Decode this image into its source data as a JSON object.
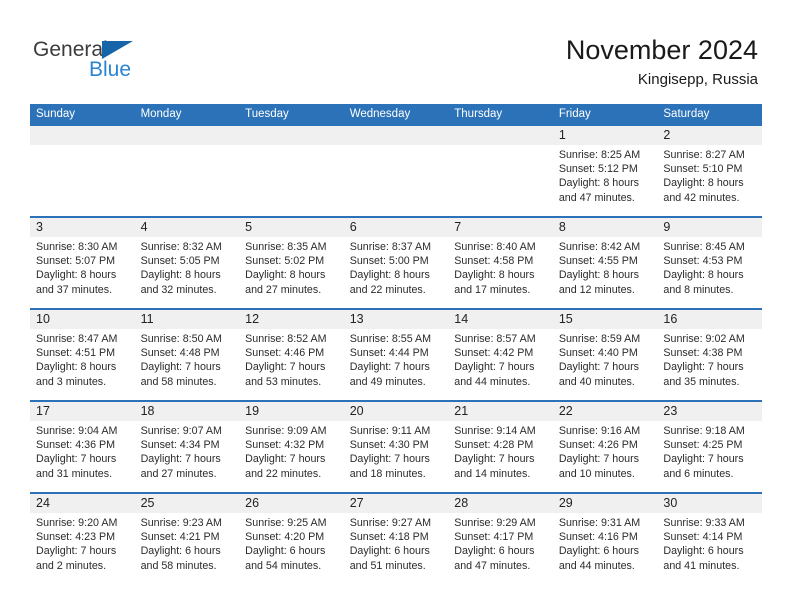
{
  "brand": {
    "name_top": "General",
    "name_bottom": "Blue",
    "color_dark": "#3c3c3c",
    "color_blue": "#2a84d2",
    "triangle_color": "#1565a8"
  },
  "header": {
    "month_title": "November 2024",
    "location": "Kingisepp, Russia"
  },
  "theme": {
    "header_blue": "#2c72b8",
    "date_band_gray": "#f0f0f0",
    "text": "#2b2b2b"
  },
  "weekday_headers": [
    "Sunday",
    "Monday",
    "Tuesday",
    "Wednesday",
    "Thursday",
    "Friday",
    "Saturday"
  ],
  "weeks": [
    [
      {
        "date": "",
        "lines": []
      },
      {
        "date": "",
        "lines": []
      },
      {
        "date": "",
        "lines": []
      },
      {
        "date": "",
        "lines": []
      },
      {
        "date": "",
        "lines": []
      },
      {
        "date": "1",
        "lines": [
          "Sunrise: 8:25 AM",
          "Sunset: 5:12 PM",
          "Daylight: 8 hours",
          "and 47 minutes."
        ]
      },
      {
        "date": "2",
        "lines": [
          "Sunrise: 8:27 AM",
          "Sunset: 5:10 PM",
          "Daylight: 8 hours",
          "and 42 minutes."
        ]
      }
    ],
    [
      {
        "date": "3",
        "lines": [
          "Sunrise: 8:30 AM",
          "Sunset: 5:07 PM",
          "Daylight: 8 hours",
          "and 37 minutes."
        ]
      },
      {
        "date": "4",
        "lines": [
          "Sunrise: 8:32 AM",
          "Sunset: 5:05 PM",
          "Daylight: 8 hours",
          "and 32 minutes."
        ]
      },
      {
        "date": "5",
        "lines": [
          "Sunrise: 8:35 AM",
          "Sunset: 5:02 PM",
          "Daylight: 8 hours",
          "and 27 minutes."
        ]
      },
      {
        "date": "6",
        "lines": [
          "Sunrise: 8:37 AM",
          "Sunset: 5:00 PM",
          "Daylight: 8 hours",
          "and 22 minutes."
        ]
      },
      {
        "date": "7",
        "lines": [
          "Sunrise: 8:40 AM",
          "Sunset: 4:58 PM",
          "Daylight: 8 hours",
          "and 17 minutes."
        ]
      },
      {
        "date": "8",
        "lines": [
          "Sunrise: 8:42 AM",
          "Sunset: 4:55 PM",
          "Daylight: 8 hours",
          "and 12 minutes."
        ]
      },
      {
        "date": "9",
        "lines": [
          "Sunrise: 8:45 AM",
          "Sunset: 4:53 PM",
          "Daylight: 8 hours",
          "and 8 minutes."
        ]
      }
    ],
    [
      {
        "date": "10",
        "lines": [
          "Sunrise: 8:47 AM",
          "Sunset: 4:51 PM",
          "Daylight: 8 hours",
          "and 3 minutes."
        ]
      },
      {
        "date": "11",
        "lines": [
          "Sunrise: 8:50 AM",
          "Sunset: 4:48 PM",
          "Daylight: 7 hours",
          "and 58 minutes."
        ]
      },
      {
        "date": "12",
        "lines": [
          "Sunrise: 8:52 AM",
          "Sunset: 4:46 PM",
          "Daylight: 7 hours",
          "and 53 minutes."
        ]
      },
      {
        "date": "13",
        "lines": [
          "Sunrise: 8:55 AM",
          "Sunset: 4:44 PM",
          "Daylight: 7 hours",
          "and 49 minutes."
        ]
      },
      {
        "date": "14",
        "lines": [
          "Sunrise: 8:57 AM",
          "Sunset: 4:42 PM",
          "Daylight: 7 hours",
          "and 44 minutes."
        ]
      },
      {
        "date": "15",
        "lines": [
          "Sunrise: 8:59 AM",
          "Sunset: 4:40 PM",
          "Daylight: 7 hours",
          "and 40 minutes."
        ]
      },
      {
        "date": "16",
        "lines": [
          "Sunrise: 9:02 AM",
          "Sunset: 4:38 PM",
          "Daylight: 7 hours",
          "and 35 minutes."
        ]
      }
    ],
    [
      {
        "date": "17",
        "lines": [
          "Sunrise: 9:04 AM",
          "Sunset: 4:36 PM",
          "Daylight: 7 hours",
          "and 31 minutes."
        ]
      },
      {
        "date": "18",
        "lines": [
          "Sunrise: 9:07 AM",
          "Sunset: 4:34 PM",
          "Daylight: 7 hours",
          "and 27 minutes."
        ]
      },
      {
        "date": "19",
        "lines": [
          "Sunrise: 9:09 AM",
          "Sunset: 4:32 PM",
          "Daylight: 7 hours",
          "and 22 minutes."
        ]
      },
      {
        "date": "20",
        "lines": [
          "Sunrise: 9:11 AM",
          "Sunset: 4:30 PM",
          "Daylight: 7 hours",
          "and 18 minutes."
        ]
      },
      {
        "date": "21",
        "lines": [
          "Sunrise: 9:14 AM",
          "Sunset: 4:28 PM",
          "Daylight: 7 hours",
          "and 14 minutes."
        ]
      },
      {
        "date": "22",
        "lines": [
          "Sunrise: 9:16 AM",
          "Sunset: 4:26 PM",
          "Daylight: 7 hours",
          "and 10 minutes."
        ]
      },
      {
        "date": "23",
        "lines": [
          "Sunrise: 9:18 AM",
          "Sunset: 4:25 PM",
          "Daylight: 7 hours",
          "and 6 minutes."
        ]
      }
    ],
    [
      {
        "date": "24",
        "lines": [
          "Sunrise: 9:20 AM",
          "Sunset: 4:23 PM",
          "Daylight: 7 hours",
          "and 2 minutes."
        ]
      },
      {
        "date": "25",
        "lines": [
          "Sunrise: 9:23 AM",
          "Sunset: 4:21 PM",
          "Daylight: 6 hours",
          "and 58 minutes."
        ]
      },
      {
        "date": "26",
        "lines": [
          "Sunrise: 9:25 AM",
          "Sunset: 4:20 PM",
          "Daylight: 6 hours",
          "and 54 minutes."
        ]
      },
      {
        "date": "27",
        "lines": [
          "Sunrise: 9:27 AM",
          "Sunset: 4:18 PM",
          "Daylight: 6 hours",
          "and 51 minutes."
        ]
      },
      {
        "date": "28",
        "lines": [
          "Sunrise: 9:29 AM",
          "Sunset: 4:17 PM",
          "Daylight: 6 hours",
          "and 47 minutes."
        ]
      },
      {
        "date": "29",
        "lines": [
          "Sunrise: 9:31 AM",
          "Sunset: 4:16 PM",
          "Daylight: 6 hours",
          "and 44 minutes."
        ]
      },
      {
        "date": "30",
        "lines": [
          "Sunrise: 9:33 AM",
          "Sunset: 4:14 PM",
          "Daylight: 6 hours",
          "and 41 minutes."
        ]
      }
    ]
  ]
}
